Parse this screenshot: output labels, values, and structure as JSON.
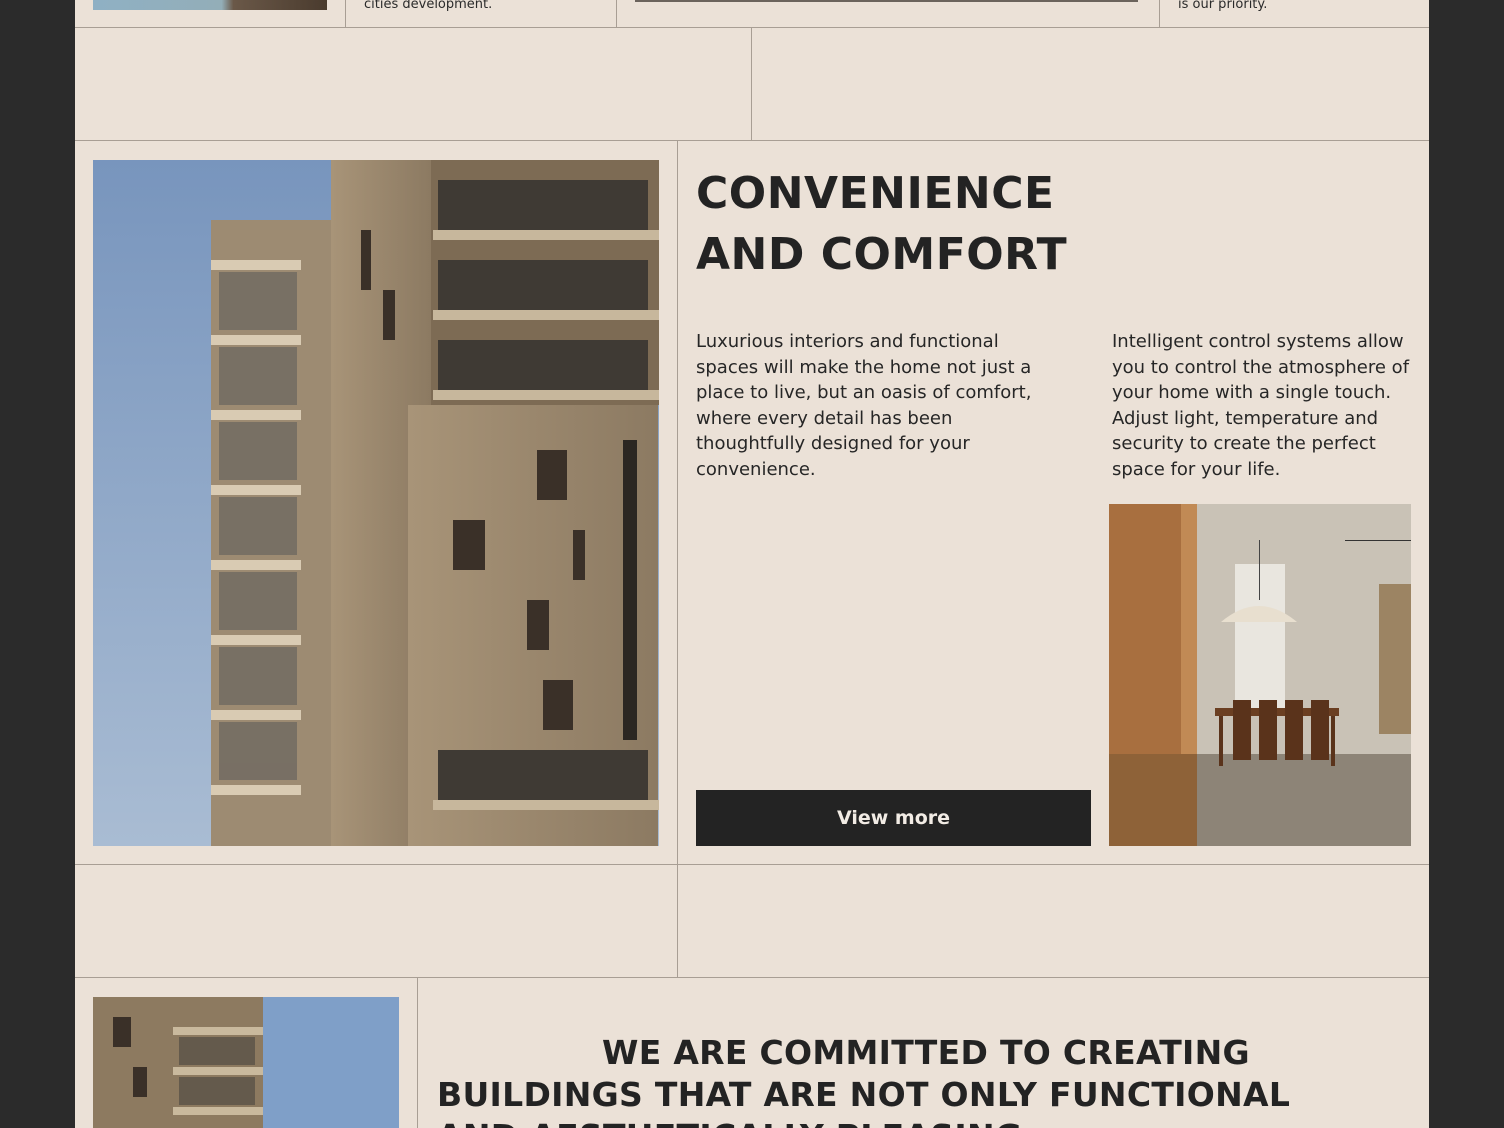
{
  "top_row": {
    "col2_text": "cities development.",
    "col4_text": "is our priority."
  },
  "feature": {
    "heading_line1": "CONVENIENCE",
    "heading_line2": "AND COMFORT",
    "paragraph_left": "Luxurious interiors and functional spaces will make the home not just a place to live, but an oasis of comfort, where every detail has been thoughtfully designed for your convenience.",
    "paragraph_right": "Intelligent control systems allow you to control the atmosphere of your home with a single touch. Adjust light, temperature and security to create the perfect space for your life.",
    "button_label": "View more"
  },
  "commitment": {
    "text": "WE ARE COMMITTED TO CREATING BUILDINGS THAT ARE NOT ONLY FUNCTIONAL AND AESTHETICALLY PLEASING"
  },
  "colors": {
    "background": "#ebe1d7",
    "frame": "#2b2b2b",
    "button": "#232323",
    "text": "#1e1e1e"
  }
}
